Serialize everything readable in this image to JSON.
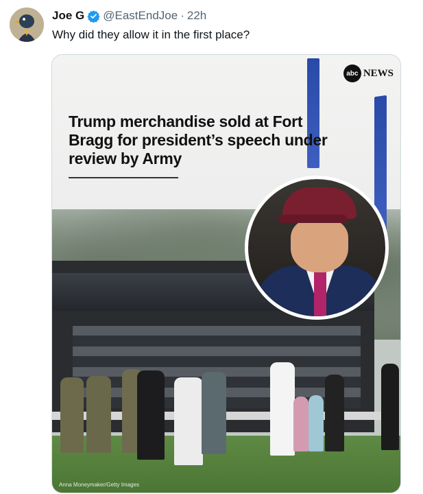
{
  "tweet": {
    "author_name": "Joe G",
    "handle": "@EastEndJoe",
    "separator": "·",
    "time": "22h",
    "text": "Why did they allow it in the first place?",
    "verified_color": "#1d9bf0"
  },
  "media": {
    "logo_abc": "abc",
    "logo_news": "NEWS",
    "headline": "Trump merchandise sold at Fort Bragg for president’s speech under review by Army",
    "photo_credit": "Anna Moneymaker/Getty Images"
  }
}
